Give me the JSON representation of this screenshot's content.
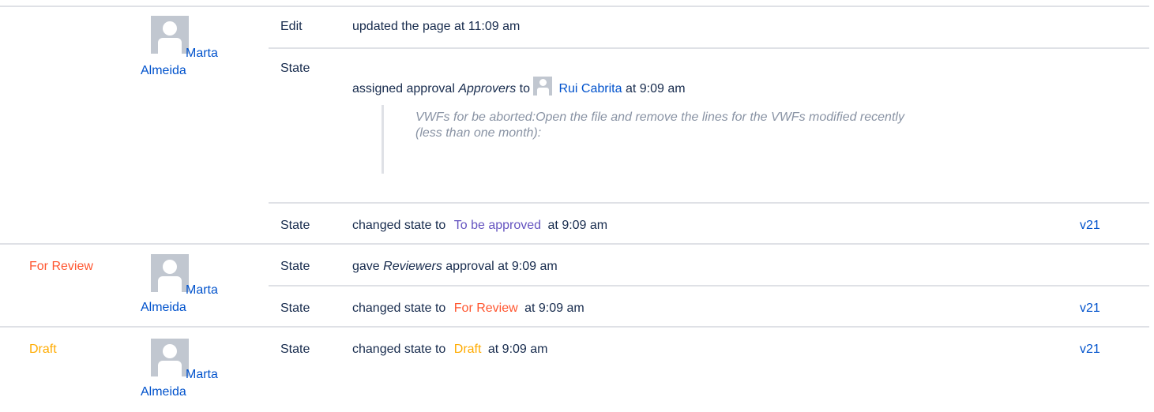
{
  "groups": [
    {
      "state_label": "",
      "author": {
        "first": "Marta",
        "last": "Almeida"
      },
      "entries": [
        {
          "type": "Edit",
          "text": "updated the page at 11:09 am"
        },
        {
          "type": "State",
          "prefix": "assigned approval ",
          "emphasis": "Approvers",
          "middle": " to ",
          "assignee": "Rui Cabrita",
          "suffix": " at 9:09 am",
          "quote": "VWFs for be aborted:Open the file and remove the lines for the VWFs modified recently (less than one month):"
        },
        {
          "type": "State",
          "prefix": "changed state to ",
          "state": "To be approved",
          "state_color": "#6554c0",
          "suffix": " at 9:09 am",
          "version": "v21"
        }
      ]
    },
    {
      "state_label": "For Review",
      "state_color": "#ff5630",
      "author": {
        "first": "Marta",
        "last": "Almeida"
      },
      "entries": [
        {
          "type": "State",
          "prefix": "gave ",
          "emphasis": "Reviewers",
          "suffix": " approval at 9:09 am"
        },
        {
          "type": "State",
          "prefix": "changed state to ",
          "state": "For Review",
          "state_color": "#ff5630",
          "suffix": " at 9:09 am",
          "version": "v21"
        }
      ]
    },
    {
      "state_label": "Draft",
      "state_color": "#ffab00",
      "author": {
        "first": "Marta",
        "last": "Almeida"
      },
      "entries": [
        {
          "type": "State",
          "prefix": "changed state to ",
          "state": "Draft",
          "state_color": "#ffab00",
          "suffix": " at 9:09 am",
          "version": "v21"
        }
      ]
    }
  ],
  "icons": {
    "avatar": "user-avatar-icon"
  },
  "colors": {
    "divider": "#dfe1e6",
    "link": "#0052cc",
    "avatar_bg": "#c1c7d0"
  }
}
